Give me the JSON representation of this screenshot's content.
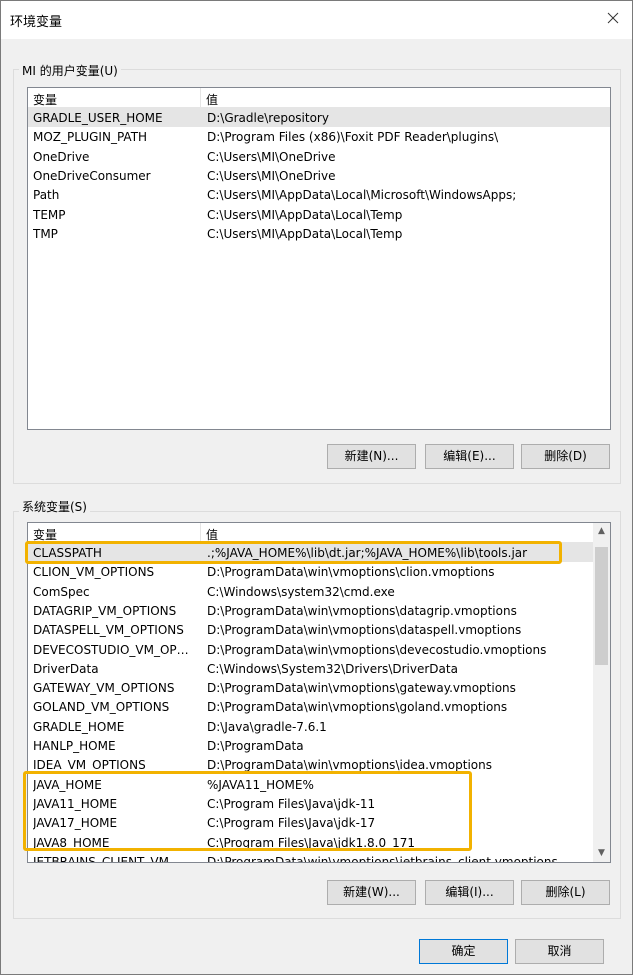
{
  "window": {
    "title": "环境变量",
    "close_icon": "close-icon"
  },
  "user_vars": {
    "group_label": "MI 的用户变量(U)",
    "col_name": "变量",
    "col_value": "值",
    "rows": [
      {
        "name": "GRADLE_USER_HOME",
        "value": "D:\\Gradle\\repository"
      },
      {
        "name": "MOZ_PLUGIN_PATH",
        "value": "D:\\Program Files (x86)\\Foxit PDF Reader\\plugins\\"
      },
      {
        "name": "OneDrive",
        "value": "C:\\Users\\MI\\OneDrive"
      },
      {
        "name": "OneDriveConsumer",
        "value": "C:\\Users\\MI\\OneDrive"
      },
      {
        "name": "Path",
        "value": "C:\\Users\\MI\\AppData\\Local\\Microsoft\\WindowsApps;"
      },
      {
        "name": "TEMP",
        "value": "C:\\Users\\MI\\AppData\\Local\\Temp"
      },
      {
        "name": "TMP",
        "value": "C:\\Users\\MI\\AppData\\Local\\Temp"
      }
    ],
    "buttons": {
      "new": "新建(N)...",
      "edit": "编辑(E)...",
      "delete": "删除(D)"
    }
  },
  "system_vars": {
    "group_label": "系统变量(S)",
    "col_name": "变量",
    "col_value": "值",
    "rows": [
      {
        "name": "CLASSPATH",
        "value": ".;%JAVA_HOME%\\lib\\dt.jar;%JAVA_HOME%\\lib\\tools.jar"
      },
      {
        "name": "CLION_VM_OPTIONS",
        "value": "D:\\ProgramData\\win\\vmoptions\\clion.vmoptions"
      },
      {
        "name": "ComSpec",
        "value": "C:\\Windows\\system32\\cmd.exe"
      },
      {
        "name": "DATAGRIP_VM_OPTIONS",
        "value": "D:\\ProgramData\\win\\vmoptions\\datagrip.vmoptions"
      },
      {
        "name": "DATASPELL_VM_OPTIONS",
        "value": "D:\\ProgramData\\win\\vmoptions\\dataspell.vmoptions"
      },
      {
        "name": "DEVECOSTUDIO_VM_OPTI...",
        "value": "D:\\ProgramData\\win\\vmoptions\\devecostudio.vmoptions"
      },
      {
        "name": "DriverData",
        "value": "C:\\Windows\\System32\\Drivers\\DriverData"
      },
      {
        "name": "GATEWAY_VM_OPTIONS",
        "value": "D:\\ProgramData\\win\\vmoptions\\gateway.vmoptions"
      },
      {
        "name": "GOLAND_VM_OPTIONS",
        "value": "D:\\ProgramData\\win\\vmoptions\\goland.vmoptions"
      },
      {
        "name": "GRADLE_HOME",
        "value": "D:\\Java\\gradle-7.6.1"
      },
      {
        "name": "HANLP_HOME",
        "value": "D:\\ProgramData"
      },
      {
        "name": "IDEA_VM_OPTIONS",
        "value": "D:\\ProgramData\\win\\vmoptions\\idea.vmoptions"
      },
      {
        "name": "JAVA_HOME",
        "value": "%JAVA11_HOME%"
      },
      {
        "name": "JAVA11_HOME",
        "value": "C:\\Program Files\\Java\\jdk-11"
      },
      {
        "name": "JAVA17_HOME",
        "value": "C:\\Program Files\\Java\\jdk-17"
      },
      {
        "name": "JAVA8_HOME",
        "value": "C:\\Program Files\\Java\\jdk1.8.0_171"
      },
      {
        "name": "JETBRAINS_CLIENT_VM_OP...",
        "value": "D:\\ProgramData\\win\\vmoptions\\jetbrains_client.vmoptions"
      }
    ],
    "buttons": {
      "new": "新建(W)...",
      "edit": "编辑(I)...",
      "delete": "删除(L)"
    }
  },
  "footer": {
    "ok": "确定",
    "cancel": "取消"
  },
  "colors": {
    "highlight": "#f2b200",
    "selected_row": "#e5e5e5"
  }
}
